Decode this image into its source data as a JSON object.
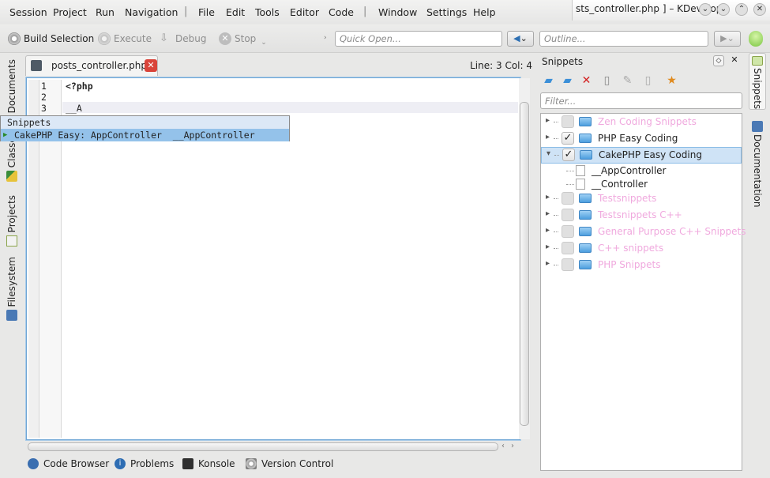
{
  "menu": [
    "Session",
    "Project",
    "Run",
    "Navigation",
    "File",
    "Edit",
    "Tools",
    "Editor",
    "Code",
    "Window",
    "Settings",
    "Help"
  ],
  "window": {
    "title": "sts_controller.php ] – KDevelop"
  },
  "toolbar": {
    "build_label": "Build Selection",
    "execute_label": "Execute",
    "debug_label": "Debug",
    "stop_label": "Stop",
    "quick_open_placeholder": "Quick Open...",
    "outline_placeholder": "Outline..."
  },
  "left_tabs": [
    "Documents",
    "Classes",
    "Projects",
    "Filesystem"
  ],
  "editor": {
    "tab_title": "posts_controller.php",
    "cursor_position": "Line: 3 Col: 4",
    "line_numbers": [
      "1",
      "2",
      "3"
    ],
    "lines": [
      "<?php",
      "",
      "__A"
    ]
  },
  "completion": {
    "header": "Snippets",
    "item": "CakePHP Easy: AppController  __AppController"
  },
  "bottom_tabs": [
    "Code Browser",
    "Problems",
    "Konsole",
    "Version Control"
  ],
  "snippets_panel": {
    "title": "Snippets",
    "filter_placeholder": "Filter...",
    "repositories": [
      {
        "label": "Zen Coding Snippets",
        "checked": false,
        "enabled": false,
        "expanded": false
      },
      {
        "label": "PHP Easy Coding",
        "checked": true,
        "enabled": true,
        "expanded": false
      },
      {
        "label": "CakePHP Easy Coding",
        "checked": true,
        "enabled": true,
        "expanded": true,
        "selected": true,
        "children": [
          "__AppController",
          "__Controller"
        ]
      },
      {
        "label": "Testsnippets",
        "checked": false,
        "enabled": false,
        "expanded": false
      },
      {
        "label": "Testsnippets C++",
        "checked": false,
        "enabled": false,
        "expanded": false
      },
      {
        "label": "General Purpose C++ Snippets",
        "checked": false,
        "enabled": false,
        "expanded": false
      },
      {
        "label": "C++ snippets",
        "checked": false,
        "enabled": false,
        "expanded": false
      },
      {
        "label": "PHP Snippets",
        "checked": false,
        "enabled": false,
        "expanded": false
      }
    ]
  },
  "right_tabs": [
    "Snippets",
    "Documentation"
  ],
  "colors": {
    "selection": "#94c2ea",
    "disabled_text": "#f0a9de",
    "folder": "#4d9fdf",
    "focus_border": "#6fa6d6"
  }
}
